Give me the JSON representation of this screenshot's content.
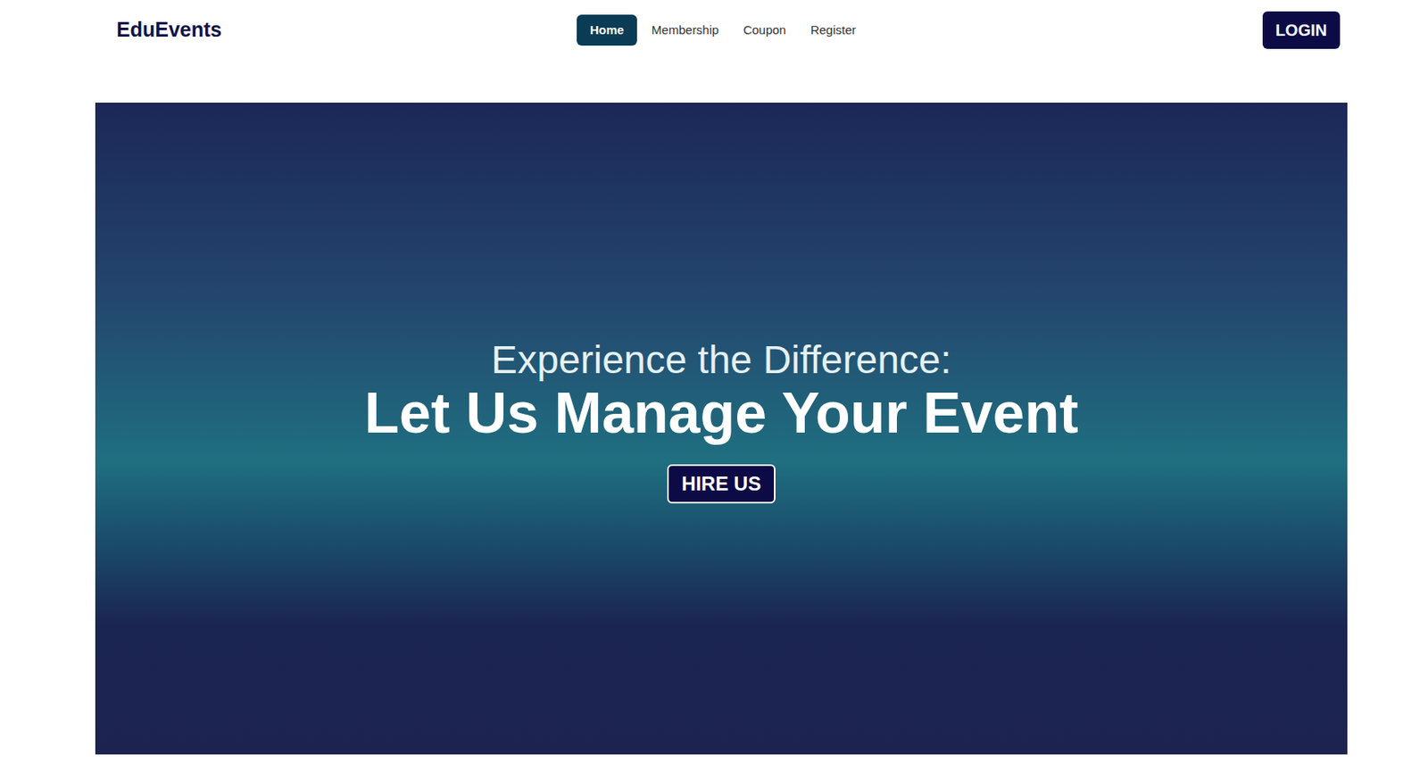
{
  "brand": "EduEvents",
  "nav": [
    {
      "label": "Home",
      "selected": true
    },
    {
      "label": "Membership",
      "selected": false
    },
    {
      "label": "Coupon",
      "selected": false
    },
    {
      "label": "Register",
      "selected": false
    }
  ],
  "login_button": "LOGIN",
  "hero": {
    "subtitle": "Experience the Difference:",
    "title": "Let Us Manage Your Event",
    "button": "HIRE US"
  }
}
